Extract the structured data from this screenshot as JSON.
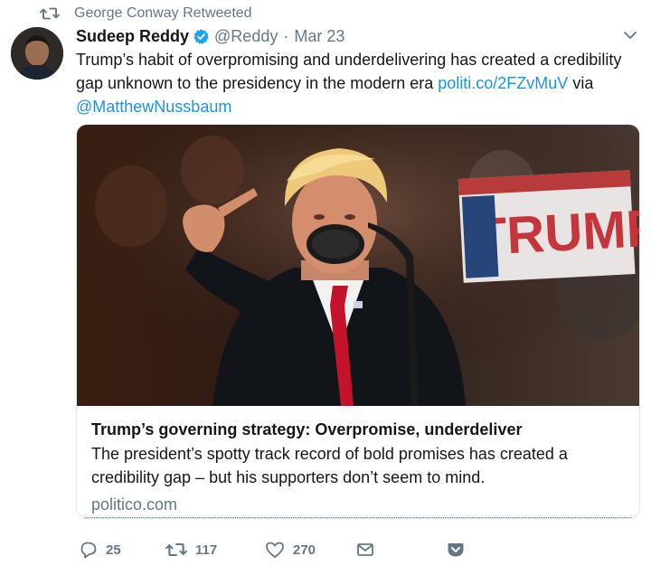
{
  "retweet": {
    "label": "George Conway Retweeted",
    "icon": "retweet-icon"
  },
  "author": {
    "name": "Sudeep Reddy",
    "handle": "@Reddy",
    "separator": "·",
    "date": "Mar 23",
    "verified_icon": "verified-badge-icon"
  },
  "tweet": {
    "text_before": "Trump’s habit of overpromising and underdelivering has created a credibility gap unknown to the presidency in the modern era ",
    "link": "politi.co/2FZvMuV",
    "text_middle": " via ",
    "mention": "@MatthewNussbaum"
  },
  "card": {
    "title": "Trump’s governing strategy: Overpromise, underdeliver",
    "description": "The president’s spotty track record of bold promises has created a credibility gap – but his supporters don’t seem to mind.",
    "domain": "politico.com"
  },
  "actions": {
    "replies": "25",
    "retweets": "117",
    "likes": "270"
  },
  "colors": {
    "link": "#1b95e0",
    "secondary": "#657786",
    "text": "#14171a",
    "verified": "#1da1f2"
  }
}
